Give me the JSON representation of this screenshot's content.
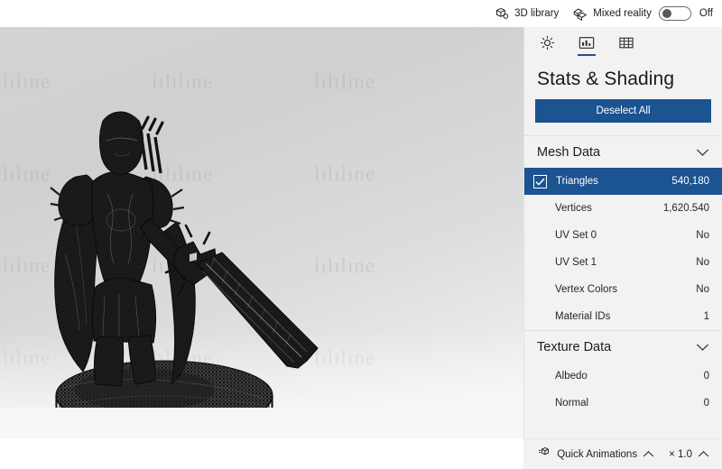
{
  "topbar": {
    "library": {
      "label": "3D library",
      "icon": "cube-library-icon"
    },
    "mixed_reality": {
      "label": "Mixed reality",
      "icon": "mixed-reality-icon"
    },
    "toggle": {
      "state_label": "Off",
      "on": false
    }
  },
  "panel": {
    "tabs": [
      {
        "name": "lighting",
        "icon": "sun-icon",
        "active": false
      },
      {
        "name": "stats",
        "icon": "stats-panel-icon",
        "active": true
      },
      {
        "name": "grid",
        "icon": "grid-icon",
        "active": false
      }
    ],
    "title": "Stats & Shading",
    "deselect_button": "Deselect All",
    "accent_color": "#1b5490",
    "background_color": "#f2f2f2",
    "sections": [
      {
        "name": "mesh-data",
        "title": "Mesh Data",
        "expanded": true,
        "rows": [
          {
            "label": "Triangles",
            "value": "540,180",
            "selected": true,
            "checked": true
          },
          {
            "label": "Vertices",
            "value": "1,620.540",
            "selected": false,
            "checked": false
          },
          {
            "label": "UV Set 0",
            "value": "No",
            "selected": false,
            "checked": false
          },
          {
            "label": "UV Set 1",
            "value": "No",
            "selected": false,
            "checked": false
          },
          {
            "label": "Vertex Colors",
            "value": "No",
            "selected": false,
            "checked": false
          },
          {
            "label": "Material IDs",
            "value": "1",
            "selected": false,
            "checked": false
          }
        ]
      },
      {
        "name": "texture-data",
        "title": "Texture Data",
        "expanded": true,
        "rows": [
          {
            "label": "Albedo",
            "value": "0",
            "selected": false,
            "checked": false
          },
          {
            "label": "Normal",
            "value": "0",
            "selected": false,
            "checked": false
          }
        ]
      }
    ]
  },
  "bottombar": {
    "quick_animations": {
      "label": "Quick Animations",
      "icon": "animation-cube-icon"
    },
    "speed": {
      "label": "× 1.0"
    }
  },
  "viewport": {
    "watermark_text": "lılılıne",
    "model_description": "Wireframe 3D model of an armored female warrior holding a large sword, standing on a round rocky base",
    "background_top_color": "#d2d3d4",
    "background_bottom_color": "#f4f4f4"
  }
}
